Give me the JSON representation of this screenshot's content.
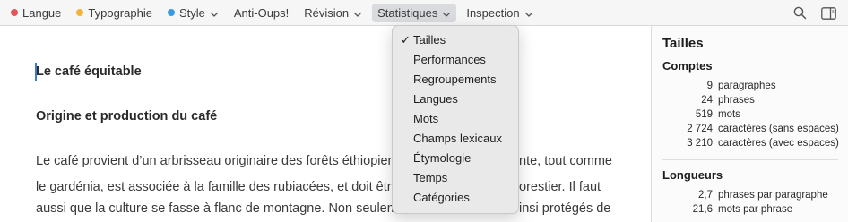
{
  "toolbar": {
    "items": [
      {
        "label": "Langue",
        "dot": "#e0565b",
        "chevron": false
      },
      {
        "label": "Typographie",
        "dot": "#f0b43c",
        "chevron": false
      },
      {
        "label": "Style",
        "dot": "#3a9be0",
        "chevron": true
      },
      {
        "label": "Anti-Oups!",
        "dot": null,
        "chevron": false
      },
      {
        "label": "Révision",
        "dot": null,
        "chevron": true
      },
      {
        "label": "Statistiques",
        "dot": null,
        "chevron": true,
        "active": true
      },
      {
        "label": "Inspection",
        "dot": null,
        "chevron": true
      }
    ],
    "right_icons": [
      "search-icon",
      "sidebar-toggle-icon"
    ]
  },
  "menu": {
    "items": [
      {
        "label": "Tailles",
        "checked": true
      },
      {
        "label": "Performances",
        "checked": false
      },
      {
        "label": "Regroupements",
        "checked": false
      },
      {
        "label": "Langues",
        "checked": false
      },
      {
        "label": "Mots",
        "checked": false
      },
      {
        "label": "Champs lexicaux",
        "checked": false
      },
      {
        "label": "Étymologie",
        "checked": false
      },
      {
        "label": "Temps",
        "checked": false
      },
      {
        "label": "Catégories",
        "checked": false
      }
    ],
    "check_glyph": "✓"
  },
  "document": {
    "title": "Le café équitable",
    "heading": "Origine et production du café",
    "lines": [
      "Le café provient d’un arbrisseau originaire des forêts éthiopienne",
      "le gardénia, est associée à la famille des rubiacées, et doit être c",
      "aussi que la culture se fasse à flanc de montagne. Non seuleme"
    ],
    "lines_right": [
      "nte, tout comme",
      "orestier. Il faut",
      "insi protégés de"
    ]
  },
  "sidebar": {
    "title": "Tailles",
    "sections": [
      {
        "title": "Comptes",
        "rows": [
          {
            "value": "9",
            "label": "paragraphes"
          },
          {
            "value": "24",
            "label": "phrases"
          },
          {
            "value": "519",
            "label": "mots"
          },
          {
            "value": "2 724",
            "label": "caractères (sans espaces)"
          },
          {
            "value": "3 210",
            "label": "caractères (avec espaces)"
          }
        ]
      },
      {
        "title": "Longueurs",
        "rows": [
          {
            "value": "2,7",
            "label": "phrases par paragraphe"
          },
          {
            "value": "21,6",
            "label": "mots par phrase"
          }
        ]
      }
    ]
  }
}
